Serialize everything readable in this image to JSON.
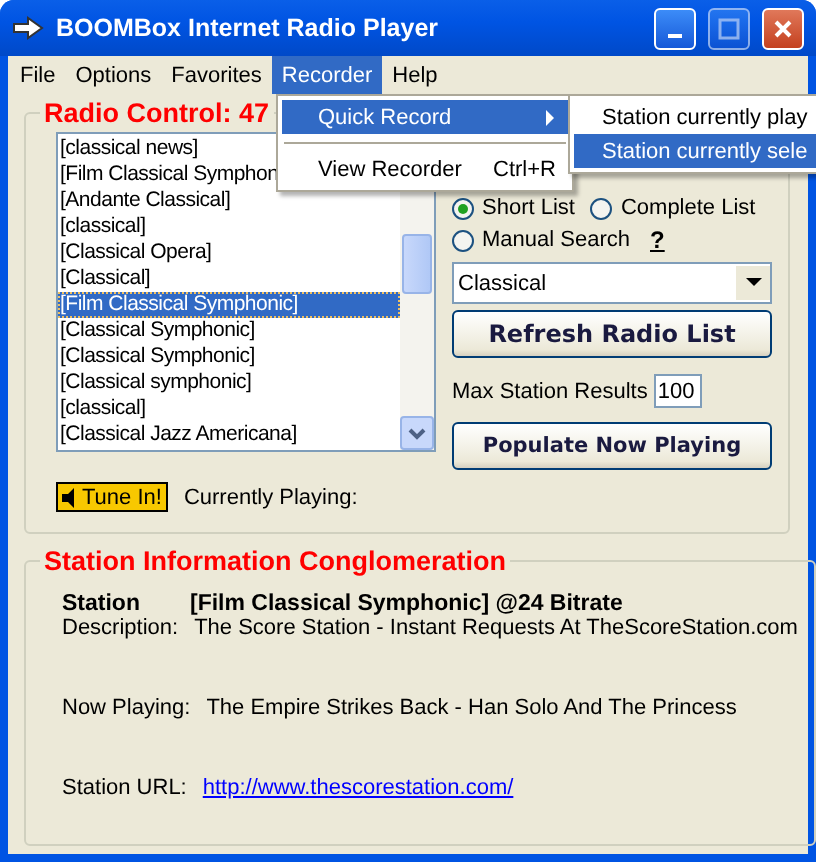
{
  "window": {
    "title": "BOOMBox Internet Radio Player"
  },
  "menu_bar": [
    {
      "label": "File",
      "selected": false
    },
    {
      "label": "Options",
      "selected": false
    },
    {
      "label": "Favorites",
      "selected": false
    },
    {
      "label": "Recorder",
      "selected": true
    },
    {
      "label": "Help",
      "selected": false
    }
  ],
  "open_menu": {
    "items": [
      {
        "kind": "submenu",
        "label": "Quick Record",
        "selected": true
      },
      {
        "kind": "separator"
      },
      {
        "kind": "item",
        "label": "View Recorder",
        "shortcut": "Ctrl+R",
        "selected": false
      }
    ]
  },
  "submenu": {
    "items": [
      {
        "label": "Station currently play",
        "selected": false
      },
      {
        "label": "Station currently sele",
        "selected": true
      }
    ]
  },
  "radio_control": {
    "title": "Radio Control: 47",
    "stations": [
      {
        "label": "[classical news]",
        "selected": false
      },
      {
        "label": "[Film Classical Symphon",
        "selected": false
      },
      {
        "label": "[Andante Classical]",
        "selected": false
      },
      {
        "label": "[classical]",
        "selected": false
      },
      {
        "label": "[Classical  Opera]",
        "selected": false
      },
      {
        "label": "[Classical]",
        "selected": false
      },
      {
        "label": "[Film Classical Symphonic]",
        "selected": true
      },
      {
        "label": "[Classical Symphonic]",
        "selected": false
      },
      {
        "label": "[Classical Symphonic]",
        "selected": false
      },
      {
        "label": "[Classical symphonic]",
        "selected": false
      },
      {
        "label": "[classical]",
        "selected": false
      },
      {
        "label": "[Classical Jazz Americana]",
        "selected": false
      }
    ],
    "list_type": [
      {
        "label": "Short List",
        "selected": true
      },
      {
        "label": "Complete List",
        "selected": false
      }
    ],
    "manual_search": {
      "label": "Manual Search",
      "selected": false,
      "help": "?"
    },
    "category": {
      "value": "Classical"
    },
    "refresh_button": "Refresh Radio List",
    "max_results": {
      "label": "Max Station Results",
      "value": "100"
    },
    "populate_button": "Populate Now Playing",
    "tune_in_button": "Tune In!",
    "currently_playing": "Currently Playing:"
  },
  "station_info": {
    "title": "Station Information Conglomeration",
    "rows": [
      {
        "kind": "bold",
        "label": "Station",
        "value": "[Film Classical Symphonic] @24 Bitrate"
      },
      {
        "kind": "text",
        "label": "Description:",
        "value": "The Score Station - Instant Requests At TheScoreStation.com"
      },
      {
        "kind": "text",
        "label": "Now Playing:",
        "value": "The Empire Strikes Back - Han Solo And The Princess"
      },
      {
        "kind": "link",
        "label": "Station URL:",
        "value": "http://www.thescorestation.com/"
      }
    ]
  }
}
